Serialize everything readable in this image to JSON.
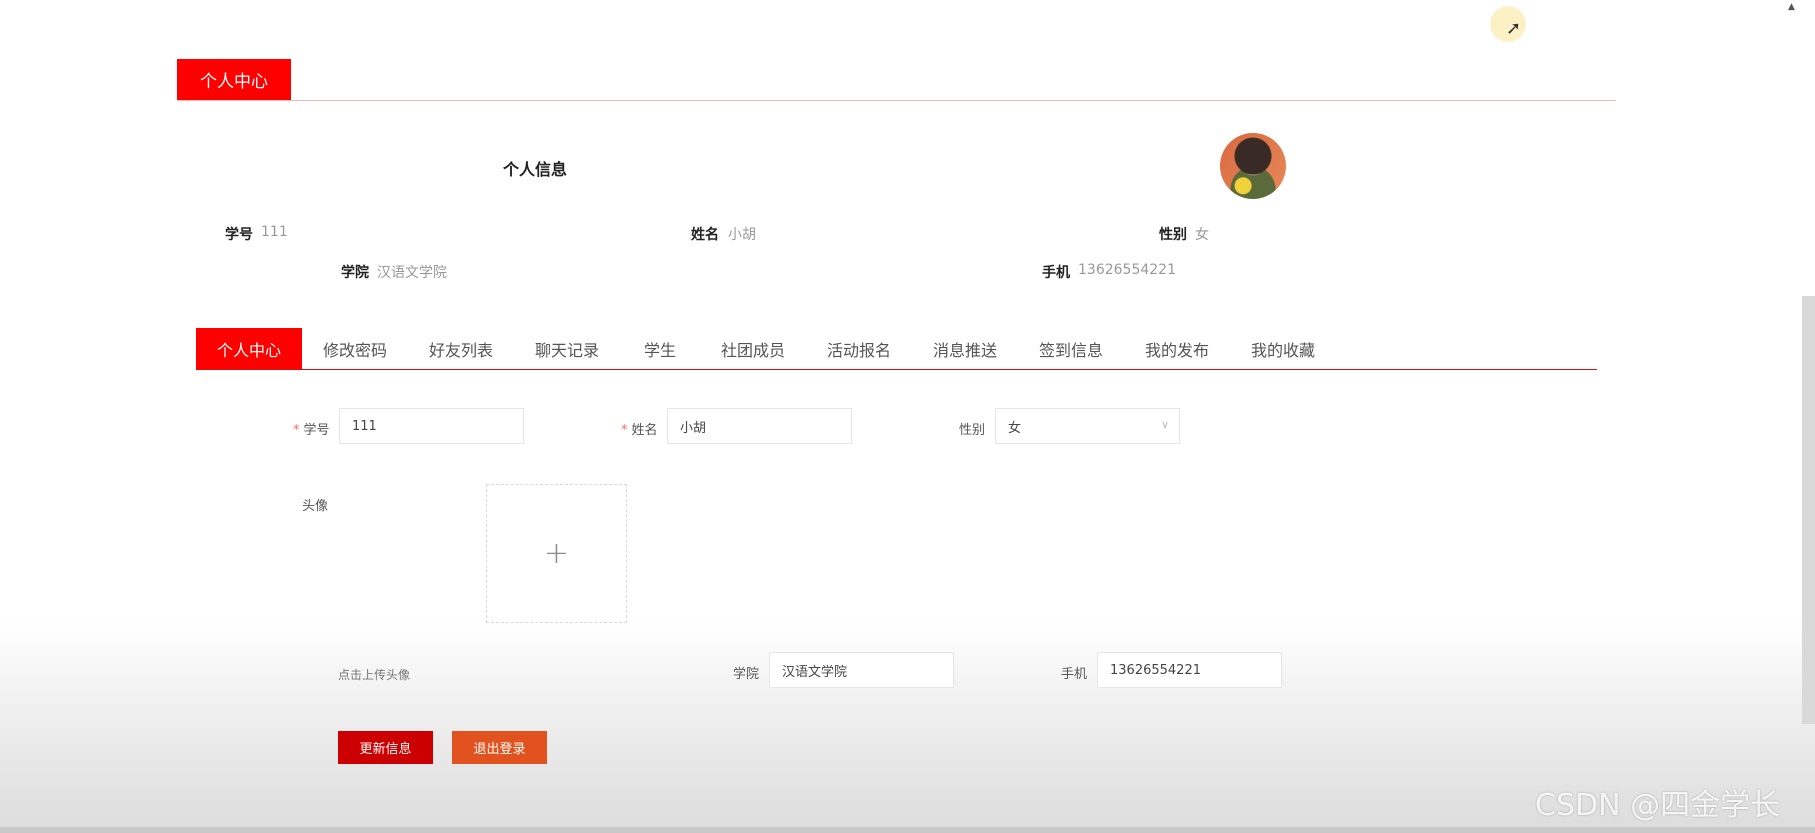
{
  "section_header": {
    "title": "个人中心"
  },
  "profile": {
    "title": "个人信息",
    "fields": [
      {
        "label": "学号",
        "value": "111"
      },
      {
        "label": "姓名",
        "value": "小胡"
      },
      {
        "label": "性别",
        "value": "女"
      },
      {
        "label": "学院",
        "value": "汉语文学院"
      },
      {
        "label": "手机",
        "value": "13626554221"
      }
    ]
  },
  "tabs": [
    {
      "label": "个人中心",
      "active": true
    },
    {
      "label": "修改密码"
    },
    {
      "label": "好友列表"
    },
    {
      "label": "聊天记录"
    },
    {
      "label": "学生"
    },
    {
      "label": "社团成员"
    },
    {
      "label": "活动报名"
    },
    {
      "label": "消息推送"
    },
    {
      "label": "签到信息"
    },
    {
      "label": "我的发布"
    },
    {
      "label": "我的收藏"
    }
  ],
  "form": {
    "student_id": {
      "label": "学号",
      "value": "111",
      "required": true
    },
    "name": {
      "label": "姓名",
      "value": "小胡",
      "required": true
    },
    "gender": {
      "label": "性别",
      "value": "女"
    },
    "avatar": {
      "label": "头像",
      "hint": "点击上传头像",
      "plus": "+"
    },
    "college": {
      "label": "学院",
      "value": "汉语文学院"
    },
    "phone": {
      "label": "手机",
      "value": "13626554221"
    },
    "required_mark": "*"
  },
  "buttons": {
    "update": "更新信息",
    "logout": "退出登录"
  },
  "watermark": "CSDN @四金学长",
  "colors": {
    "accent": "#ff0000",
    "update_button": "#cc0000",
    "logout_button": "#e2521e"
  }
}
